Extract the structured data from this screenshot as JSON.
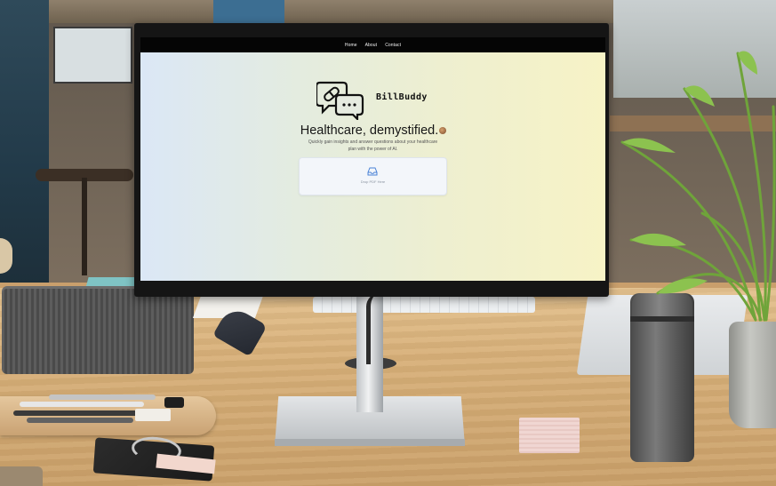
{
  "nav": {
    "items": [
      {
        "label": "Home"
      },
      {
        "label": "About"
      },
      {
        "label": "Contact"
      }
    ]
  },
  "brand": {
    "name": "BillBuddy",
    "logo_icon": "chat-bubbles-pill-icon"
  },
  "hero": {
    "title": "Healthcare, demystified.",
    "subtitle_line1": "Quickly gain insights and answer questions about your healthcare",
    "subtitle_line2": "plan with the power of AI."
  },
  "upload": {
    "icon": "inbox-tray-icon",
    "label": "Drop PDF Here",
    "accent": "#4a82d6"
  },
  "colors": {
    "nav_bg": "#050505",
    "gradient_start": "#dbe7f6",
    "gradient_end": "#f7f3c6"
  }
}
